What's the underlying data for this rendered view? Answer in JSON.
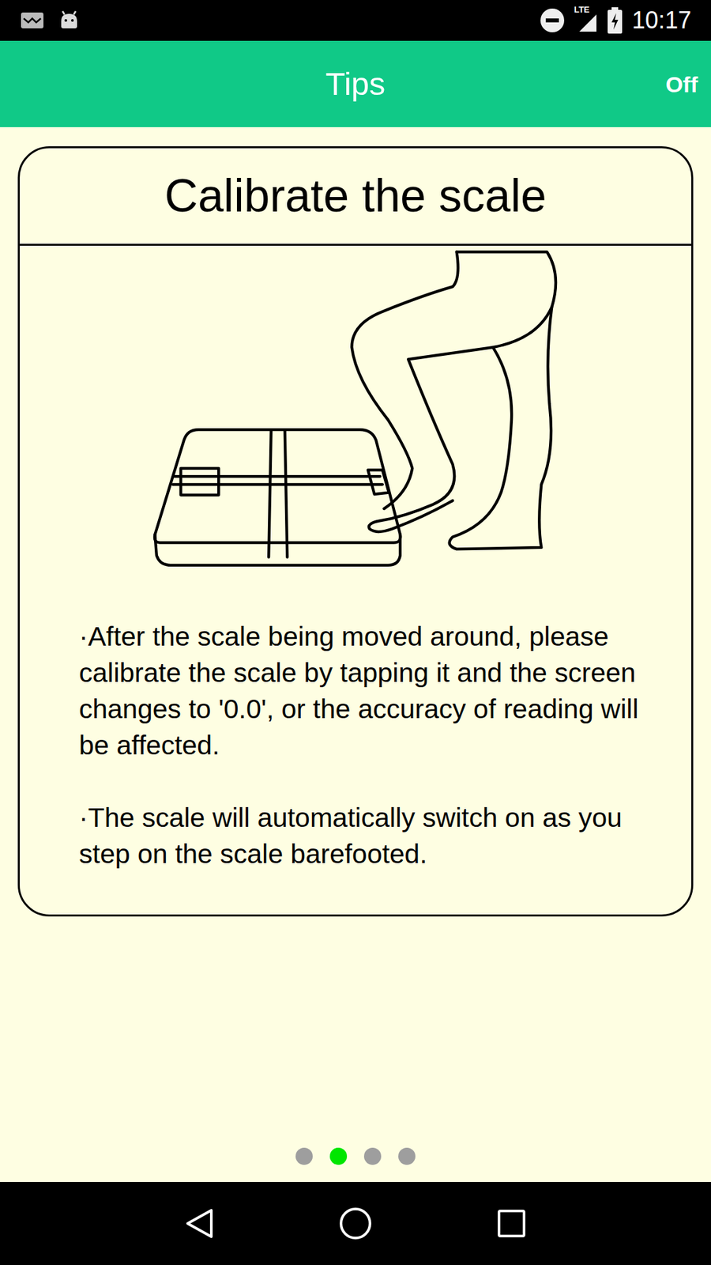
{
  "status_bar": {
    "network": "LTE",
    "time": "10:17"
  },
  "header": {
    "title": "Tips",
    "action": "Off"
  },
  "card": {
    "title": "Calibrate the scale",
    "tips": [
      "·After the scale being moved around, please calibrate the scale by tapping it and the screen changes to '0.0', or the accuracy of reading will be affected.",
      "·The scale will automatically switch on as you step on the scale barefooted."
    ]
  },
  "pager": [
    {
      "selected": false
    },
    {
      "selected": true
    },
    {
      "selected": false
    },
    {
      "selected": false
    }
  ]
}
